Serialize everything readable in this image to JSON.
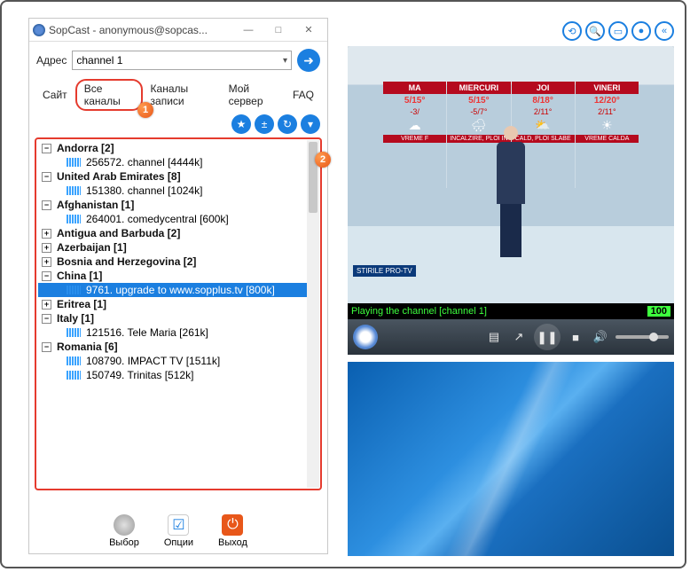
{
  "window": {
    "title": "SopCast - anonymous@sopcas...",
    "min": "—",
    "max": "□",
    "close": "✕"
  },
  "address": {
    "label": "Адрес",
    "value": "channel 1"
  },
  "tabs": {
    "items": [
      "Сайт",
      "Все каналы",
      "Каналы записи",
      "Мой сервер",
      "FAQ"
    ],
    "activeIndex": 1
  },
  "callouts": {
    "one": "1",
    "two": "2"
  },
  "tree": [
    {
      "type": "group",
      "toggle": "−",
      "label": "Andorra [2]"
    },
    {
      "type": "leaf",
      "label": "256572. channel [4444k]"
    },
    {
      "type": "group",
      "toggle": "−",
      "label": "United Arab Emirates [8]"
    },
    {
      "type": "leaf",
      "label": "151380. channel [1024k]"
    },
    {
      "type": "group",
      "toggle": "−",
      "label": "Afghanistan [1]"
    },
    {
      "type": "leaf",
      "label": "264001. comedycentral [600k]"
    },
    {
      "type": "group",
      "toggle": "+",
      "label": "Antigua and Barbuda [2]"
    },
    {
      "type": "group",
      "toggle": "+",
      "label": "Azerbaijan [1]"
    },
    {
      "type": "group",
      "toggle": "+",
      "label": "Bosnia and Herzegovina [2]"
    },
    {
      "type": "group",
      "toggle": "−",
      "label": "China [1]"
    },
    {
      "type": "leaf",
      "label": "9761. upgrade to www.sopplus.tv [800k]",
      "selected": true,
      "dim": true
    },
    {
      "type": "group",
      "toggle": "+",
      "label": "Eritrea [1]"
    },
    {
      "type": "group",
      "toggle": "−",
      "label": "Italy [1]"
    },
    {
      "type": "leaf",
      "label": "121516. Tele Maria [261k]"
    },
    {
      "type": "group",
      "toggle": "−",
      "label": "Romania [6]"
    },
    {
      "type": "leaf",
      "label": "108790. IMPACT TV [1511k]"
    },
    {
      "type": "leaf",
      "label": "150749. Trinitas [512k]"
    }
  ],
  "actions": {
    "select": "Выбор",
    "options": "Опции",
    "exit": "Выход"
  },
  "video": {
    "logo": "STIRILE PRO-TV",
    "days": [
      {
        "name": "MA",
        "t1": "5/15°",
        "t2": "-3/",
        "icon": "☁",
        "desc": "VREME F"
      },
      {
        "name": "MIERCURI",
        "t1": "5/15°",
        "t2": "-5/7°",
        "icon": "🌧",
        "desc": "INCALZIRE, PLOI IN"
      },
      {
        "name": "JOI",
        "t1": "8/18°",
        "t2": "2/11°",
        "icon": "⛅",
        "desc": "CALD, PLOI SLABE"
      },
      {
        "name": "VINERI",
        "t1": "12/20°",
        "t2": "2/11°",
        "icon": "☀",
        "desc": "VREME CALDA"
      }
    ]
  },
  "status": {
    "text": "Playing the channel [channel 1]",
    "value": "100"
  },
  "player_icons": {
    "list": "▤",
    "popout": "↗",
    "pause": "❚❚",
    "stop": "■",
    "speaker": "🔊"
  },
  "top_icons": {
    "a": "⟲",
    "b": "🔍",
    "c": "▭",
    "d": "●",
    "e": "«"
  }
}
